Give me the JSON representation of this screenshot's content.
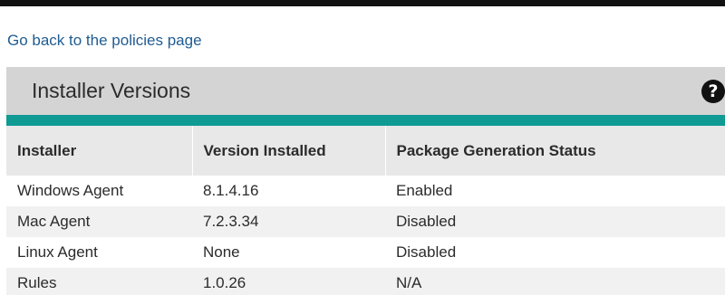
{
  "nav": {
    "back_link": "Go back to the policies page"
  },
  "panel": {
    "title": "Installer Versions",
    "help_icon": "question-circle-icon"
  },
  "colors": {
    "accent": "#0f9a94",
    "link": "#1f5c91",
    "header_bg": "#d4d4d4"
  },
  "table": {
    "headers": [
      "Installer",
      "Version Installed",
      "Package Generation Status"
    ],
    "rows": [
      [
        "Windows Agent",
        "8.1.4.16",
        "Enabled"
      ],
      [
        "Mac Agent",
        "7.2.3.34",
        "Disabled"
      ],
      [
        "Linux Agent",
        "None",
        "Disabled"
      ],
      [
        "Rules",
        "1.0.26",
        "N/A"
      ]
    ]
  }
}
